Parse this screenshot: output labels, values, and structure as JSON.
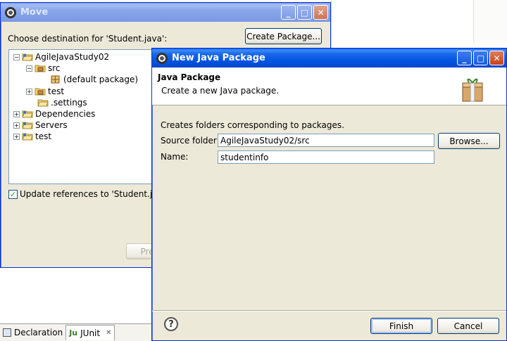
{
  "move_dialog": {
    "title": "Move",
    "choose_label": "Choose destination for 'Student.java':",
    "create_package_button": "Create Package...",
    "tree": [
      {
        "label": "AgileJavaStudy02",
        "expander": "−"
      },
      {
        "label": "src",
        "expander": "−"
      },
      {
        "label": "(default package)",
        "expander": ""
      },
      {
        "label": "test",
        "expander": "+"
      },
      {
        "label": ".settings",
        "expander": ""
      },
      {
        "label": "Dependencies",
        "expander": "+"
      },
      {
        "label": "Servers",
        "expander": "+"
      },
      {
        "label": "test",
        "expander": "+"
      }
    ],
    "update_references_label": "Update references to 'Student.java",
    "update_references_checked": true,
    "preview_button": "Pre"
  },
  "bottom_tabs": {
    "declaration": "Declaration",
    "junit": "JUnit",
    "junit_close": "✕"
  },
  "new_package_dialog": {
    "title": "New Java Package",
    "header_title": "Java Package",
    "header_desc": "Create a new Java package.",
    "info": "Creates folders corresponding to packages.",
    "source_folder_label": "Source folder:",
    "source_folder_value": "AgileJavaStudy02/src",
    "browse_button": "Browse...",
    "name_label": "Name:",
    "name_value": "studentinfo",
    "finish_button": "Finish",
    "cancel_button": "Cancel",
    "help_symbol": "?"
  },
  "window_controls": {
    "minimize": "_",
    "maximize": "□",
    "close": "✕"
  }
}
